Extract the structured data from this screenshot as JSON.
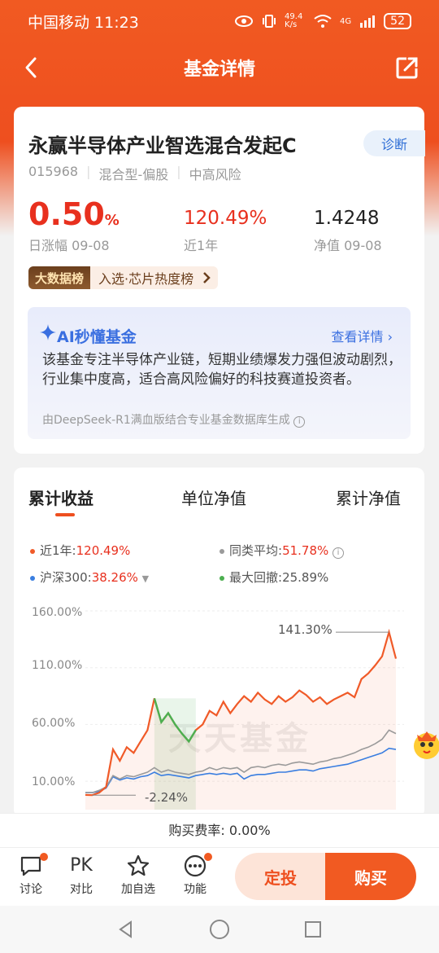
{
  "status_bar": {
    "carrier_time": "中国移动 11:23",
    "net_speed": "49.4 K/s",
    "signal": "4G",
    "battery": "52"
  },
  "nav": {
    "title": "基金详情"
  },
  "fund": {
    "name": "永赢半导体产业智选混合发起C",
    "diagnose_label": "诊断",
    "code": "015968",
    "type": "混合型-偏股",
    "risk": "中高风险",
    "daily_change": "0.50",
    "daily_change_unit": "%",
    "daily_change_label": "日涨幅 09-08",
    "year_return": "120.49%",
    "year_return_label": "近1年",
    "nav_value": "1.4248",
    "nav_label": "净值 09-08",
    "bigdata_tag": "大数据榜",
    "bigdata_text": "入选·芯片热度榜"
  },
  "ai": {
    "title": "AI秒懂基金",
    "more": "查看详情",
    "desc": "该基金专注半导体产业链，短期业绩爆发力强但波动剧烈，行业集中度高，适合高风险偏好的科技赛道投资者。",
    "source": "由DeepSeek-R1满血版结合专业基金数据库生成"
  },
  "tabs": [
    "累计收益",
    "单位净值",
    "累计净值"
  ],
  "legend": {
    "fund_label": "近1年:",
    "fund_value": "120.49%",
    "peer_label": "同类平均:",
    "peer_value": "51.78%",
    "index_label": "沪深300:",
    "index_value": "38.26%",
    "drawdown_label": "最大回撤:",
    "drawdown_value": "25.89%"
  },
  "chart_data": {
    "type": "line",
    "y_ticks": [
      "160.00%",
      "110.00%",
      "60.00%",
      "10.00%"
    ],
    "ylim": [
      -15,
      160
    ],
    "annotations": {
      "max": "141.30%",
      "min": "-2.24%"
    },
    "watermark": "天天基金",
    "series": [
      {
        "name": "近1年",
        "color": "#f05a28",
        "values": [
          -2,
          -2.24,
          0,
          5,
          38,
          28,
          40,
          35,
          45,
          55,
          83,
          62,
          70,
          60,
          52,
          45,
          55,
          60,
          72,
          68,
          80,
          70,
          78,
          85,
          80,
          88,
          82,
          78,
          85,
          80,
          84,
          90,
          86,
          80,
          84,
          78,
          82,
          85,
          88,
          84,
          100,
          105,
          112,
          120,
          141.3,
          118
        ]
      },
      {
        "name": "同类平均",
        "color": "#9a9a9a",
        "values": [
          0,
          0,
          2,
          5,
          15,
          12,
          15,
          14,
          16,
          18,
          22,
          18,
          20,
          18,
          17,
          16,
          18,
          19,
          22,
          20,
          22,
          21,
          22,
          18,
          22,
          23,
          22,
          24,
          25,
          24,
          26,
          27,
          26,
          25,
          27,
          28,
          30,
          31,
          33,
          35,
          38,
          40,
          43,
          47,
          55,
          52
        ]
      },
      {
        "name": "沪深300",
        "color": "#3a7ee0",
        "values": [
          0,
          0,
          1,
          4,
          14,
          11,
          13,
          12,
          14,
          15,
          18,
          15,
          16,
          15,
          14,
          13,
          15,
          16,
          17,
          16,
          17,
          16,
          17,
          12,
          15,
          16,
          16,
          17,
          18,
          18,
          19,
          20,
          20,
          19,
          21,
          22,
          23,
          24,
          25,
          27,
          29,
          31,
          33,
          35,
          39,
          38
        ]
      }
    ]
  },
  "fee": "购买费率: 0.00%",
  "actions": [
    "讨论",
    "对比",
    "加自选",
    "功能"
  ],
  "pk_label": "PK",
  "buttons": {
    "dingtou": "定投",
    "buy": "购买"
  }
}
